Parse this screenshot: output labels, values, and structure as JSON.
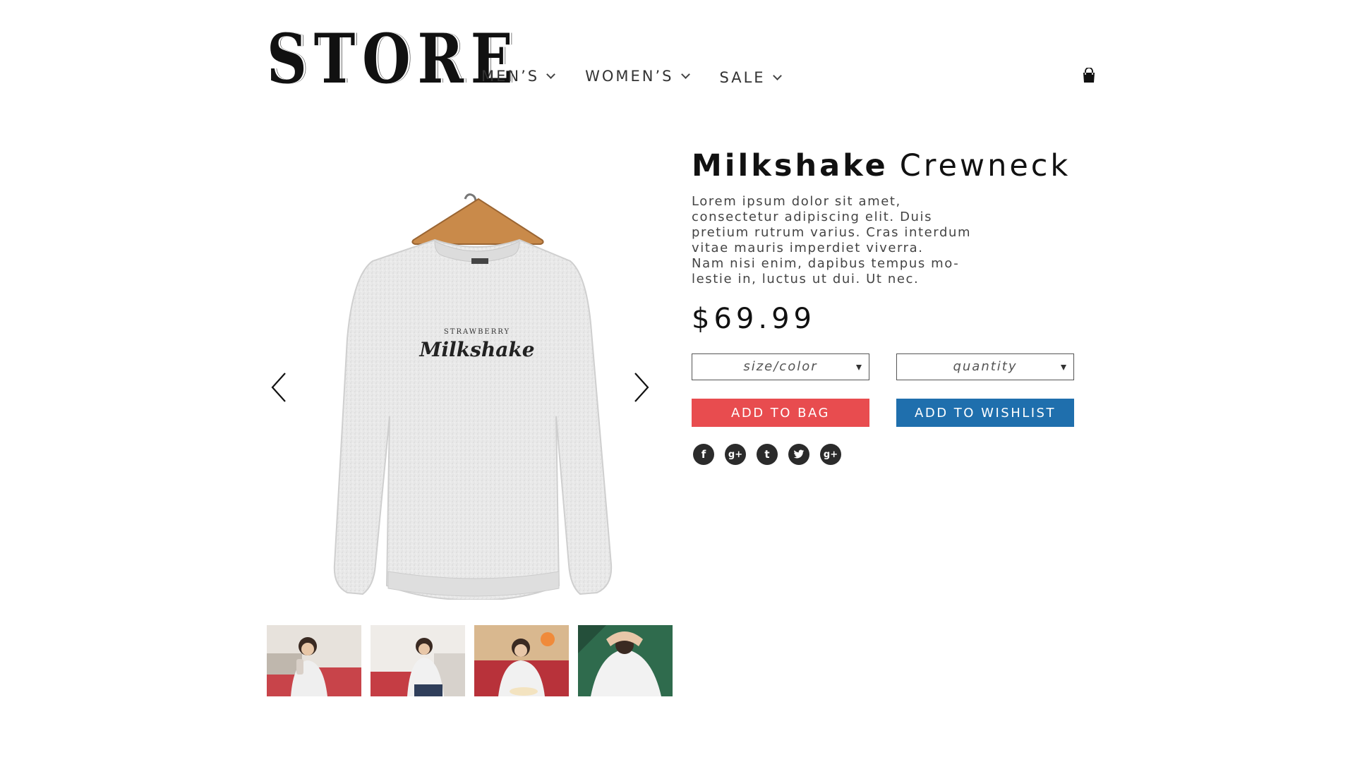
{
  "header": {
    "logo": "STORE",
    "nav": [
      {
        "label": "MEN’S"
      },
      {
        "label": "WOMEN’S"
      },
      {
        "label": "SALE"
      }
    ],
    "cart_icon": "shopping-bag-icon"
  },
  "gallery": {
    "prev_icon": "chevron-left-icon",
    "next_icon": "chevron-right-icon",
    "print_top": "STRAWBERRY",
    "print_main": "Milkshake",
    "thumbnail_count": 4
  },
  "product": {
    "title_bold": "Milkshake",
    "title_light": "Crewneck",
    "description": "Lorem ipsum dolor sit amet,\nconsectetur adipiscing elit. Duis\npretium rutrum varius. Cras interdum\nvitae mauris imperdiet viverra.\nNam nisi enim, dapibus tempus mo-\nlestie in, luctus ut dui. Ut nec.",
    "price": "$69.99",
    "size_placeholder": "size/color",
    "quantity_placeholder": "quantity",
    "add_to_bag": "ADD TO BAG",
    "add_to_wishlist": "ADD TO WISHLIST"
  },
  "social": [
    {
      "icon": "facebook-icon",
      "glyph": "f"
    },
    {
      "icon": "google-plus-icon",
      "glyph": "g+"
    },
    {
      "icon": "tumblr-icon",
      "glyph": "t"
    },
    {
      "icon": "twitter-icon",
      "glyph": "🐦"
    },
    {
      "icon": "google-plus-icon",
      "glyph": "g+"
    }
  ],
  "colors": {
    "add_to_bag": "#e84c4f",
    "add_to_wishlist": "#1f6fad",
    "social_icons": "#2b2b2b"
  }
}
